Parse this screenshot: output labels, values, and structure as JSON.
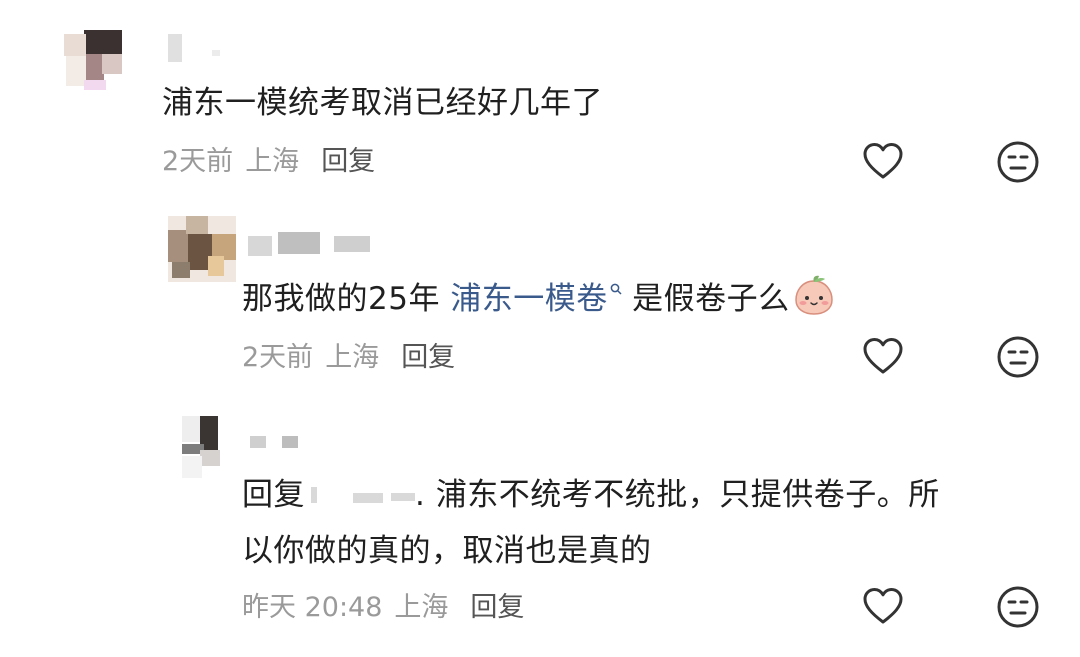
{
  "comments": [
    {
      "text": "浦东一模统考取消已经好几年了",
      "time": "2天前",
      "location": "上海",
      "reply_label": "回复"
    },
    {
      "text_before": "那我做的25年 ",
      "link": "浦东一模卷",
      "text_after": " 是假卷子么",
      "emoji": "peach-face-emoji",
      "time": "2天前",
      "location": "上海",
      "reply_label": "回复"
    },
    {
      "reply_prefix": "回复",
      "line1_after": ". 浦东不统考不统批，只提供卷子。所",
      "line2": "以你做的真的，取消也是真的",
      "time": "昨天 20:48",
      "location": "上海",
      "reply_label": "回复"
    }
  ],
  "icons": {
    "like": "heart-outline-icon",
    "dislike": "neutral-face-icon"
  },
  "colors": {
    "text": "#202020",
    "meta": "#9a9a9a",
    "link": "#3a5a8c",
    "icon": "#333333"
  }
}
